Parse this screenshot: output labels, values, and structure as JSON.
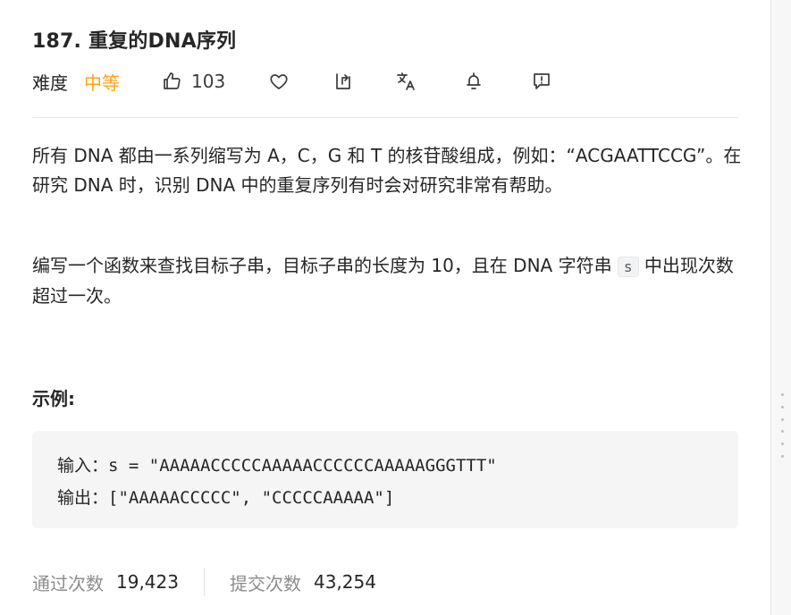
{
  "problem": {
    "title": "187. 重复的DNA序列",
    "difficulty_label": "难度",
    "difficulty": "中等",
    "likes": "103"
  },
  "icons": [
    "thumbs-up-icon",
    "heart-icon",
    "share-icon",
    "translate-icon",
    "bell-icon",
    "feedback-icon"
  ],
  "description": {
    "p1": "所有 DNA 都由一系列缩写为 A，C，G 和 T 的核苷酸组成，例如：“ACGAATTCCG”。在研究 DNA 时，识别 DNA 中的重复序列有时会对研究非常有帮助。",
    "p2_before": "编写一个函数来查找目标子串，目标子串的长度为 10，且在 DNA 字符串 ",
    "p2_code": "s",
    "p2_after": " 中出现次数超过一次。"
  },
  "example": {
    "title": "示例:",
    "input_label": "输入：",
    "input_value": "s = \"AAAAACCCCCAAAAACCCCCCAAAAAGGGTTT\"",
    "output_label": "输出：",
    "output_value": "[\"AAAAACCCCC\", \"CCCCCAAAAA\"]"
  },
  "stats": {
    "accepted_label": "通过次数",
    "accepted_value": "19,423",
    "submitted_label": "提交次数",
    "submitted_value": "43,254"
  },
  "colors": {
    "difficulty_medium": "#ffa116",
    "text": "#262626",
    "muted": "#8c8c8c",
    "code_bg": "#f5f5f5"
  }
}
